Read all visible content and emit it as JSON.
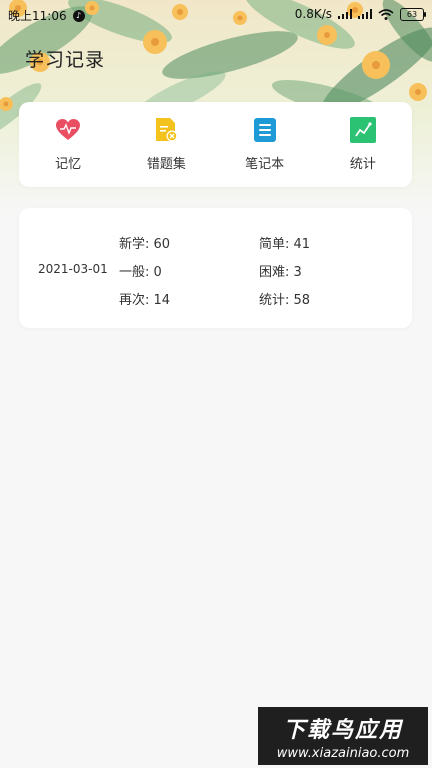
{
  "status_bar": {
    "time": "晚上11:06",
    "network_speed": "0.8K/s",
    "battery": "63"
  },
  "header": {
    "title": "学习记录"
  },
  "menu": {
    "items": [
      {
        "label": "记忆",
        "icon": "heart-icon",
        "color": "#e94e63"
      },
      {
        "label": "错题集",
        "icon": "wrong-doc-icon",
        "color": "#f4c21c"
      },
      {
        "label": "笔记本",
        "icon": "notebook-icon",
        "color": "#1e9bd7"
      },
      {
        "label": "统计",
        "icon": "chart-icon",
        "color": "#2bc273"
      }
    ]
  },
  "record": {
    "date": "2021-03-01",
    "stats": {
      "new_learn": "新学: 60",
      "simple": "简单: 41",
      "normal": "一般: 0",
      "difficult": "困难: 3",
      "again": "再次: 14",
      "total": "统计: 58"
    }
  },
  "watermark": {
    "title": "下载鸟应用",
    "url": "www.xiazainiao.com"
  }
}
